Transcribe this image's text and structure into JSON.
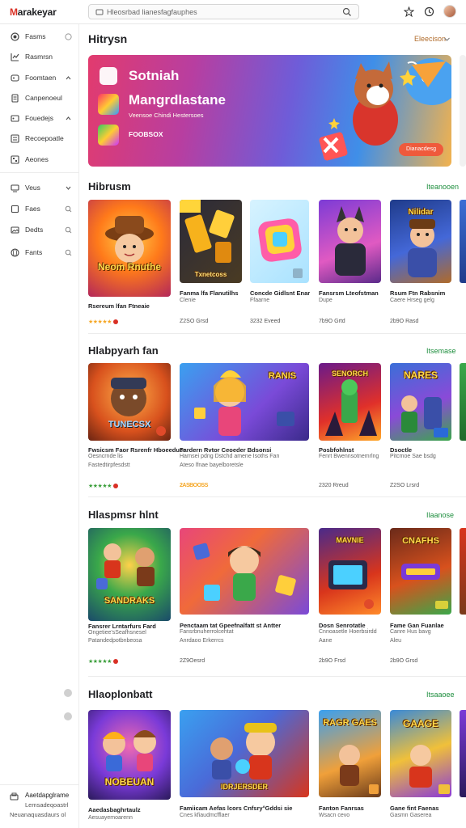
{
  "header": {
    "logo_prefix": "M",
    "logo_rest": "arakeyar",
    "search_placeholder": "Hleosrbad lianesfagfauphes",
    "icons": [
      "search-icon",
      "star-icon",
      "clock-icon",
      "avatar"
    ]
  },
  "sidebar": {
    "items": [
      {
        "label": "Fasms",
        "icon": "circle-icon",
        "right": "radio-icon"
      },
      {
        "label": "Rasmrsn",
        "icon": "chart-icon",
        "right": ""
      },
      {
        "label": "Foomtaen",
        "icon": "gamepad-icon",
        "right": "chevron-up-icon"
      },
      {
        "label": "Canpenoeul",
        "icon": "document-icon",
        "right": ""
      },
      {
        "label": "Fouedejs",
        "icon": "tag-icon",
        "right": "chevron-up-icon"
      },
      {
        "label": "Recoepoatle",
        "icon": "list-icon",
        "right": ""
      },
      {
        "label": "Aeones",
        "icon": "grid-icon",
        "right": ""
      },
      {
        "label": "Veus",
        "icon": "monitor-icon",
        "right": "chevron-down-icon"
      },
      {
        "label": "Faes",
        "icon": "square-icon",
        "right": "search-icon"
      },
      {
        "label": "Dedts",
        "icon": "image-icon",
        "right": "search-icon"
      },
      {
        "label": "Fants",
        "icon": "globe-icon",
        "right": "search-icon"
      }
    ],
    "footer": {
      "line1": "Aaetdapglrame",
      "line2": "Lemsadeqoastrl",
      "line3": "Neuanaquasdaurs ol"
    }
  },
  "main": {
    "title": "Hitrysn",
    "sort_label": "Eleecison",
    "hero": {
      "line1": "Sotniah",
      "line2": "Mangrdlastane",
      "subtitle": "Veensoe Chindi Hestersoes",
      "tag": "FOOBSOX",
      "cta": "Dianacdesg"
    },
    "sections": [
      {
        "title": "Hibrusm",
        "more": "Iteanooen",
        "cards": [
          {
            "title": "Rsereum lfan Ftneaie",
            "sub": "",
            "price": "",
            "stars": "★★★★★",
            "thumb_text": "Neom Rnuthe"
          },
          {
            "title": "Fanma lfa Flanutilhs",
            "sub": "Clenie",
            "price": "Z2SO Grsd",
            "stars": "",
            "thumb_text": "Txnetcoss"
          },
          {
            "title": "Concde Gidlsnt Enar",
            "sub": "Ffaarne",
            "price": "3232 Eveed",
            "stars": "",
            "thumb_text": ""
          },
          {
            "title": "Fansrsm Lteofstman",
            "sub": "Dupe",
            "price": "7b9O Grtd",
            "stars": "",
            "thumb_text": ""
          },
          {
            "title": "Rsum Ftn Rabsnim",
            "sub": "Caere Hrseg gelg",
            "price": "2b9O Rasd",
            "stars": "",
            "thumb_text": "Nilidar"
          }
        ]
      },
      {
        "title": "Hlabpyarh fan",
        "more": "Itsemase",
        "cards": [
          {
            "title": "Fwsicsm Faor Rsrenfr Hboeeduer",
            "sub": "Oesncrnde lis",
            "price": "Fastedtirpfesdstt",
            "stars": "★★★★★",
            "thumb_text": "TUNECSX"
          },
          {
            "title": "Fardern Rvtor Ceoeder Bdsonsi",
            "sub": "Harnsei pdng Dstchd amene Isoths Fan",
            "price": "Ateso lfnae bayelboretsle",
            "stars": "2ASBOOSS",
            "thumb_text": "RANIS"
          },
          {
            "title": "Posbfohlnst",
            "sub": "Fenrt Bwennsotnemrlng",
            "price": "2320 Rreud",
            "stars": "",
            "thumb_text": "SENORCH"
          },
          {
            "title": "Dsoctle",
            "sub": "Pitcmoe Sae bsdg",
            "price": "Z2SO Lrsrd",
            "stars": "",
            "thumb_text": "NARES"
          }
        ]
      },
      {
        "title": "Hlaspmsr hlnt",
        "more": "Ilaanose",
        "cards": [
          {
            "title": "Fansrer Lrntarfurs Fard",
            "sub": "Ongetiee'sSeafhsnesel",
            "price": "Patandedpotbnbeosa",
            "stars": "★★★★★",
            "thumb_text": "SANDRAKS"
          },
          {
            "title": "Penctaam tat Gpeefnalfatt st Antter",
            "sub": "Fansrbnuherrolcehtat",
            "price": "Anrdaoo Erkerrcs",
            "stars": "2Z9Oesrd",
            "thumb_text": ""
          },
          {
            "title": "Dosn Senrotatle",
            "sub": "Cnnoasetle Hoerbsirdd",
            "price": "Aane",
            "stars": "2b9O Frsd",
            "thumb_text": "MAVNIE"
          },
          {
            "title": "Fame Gan Fuanlae",
            "sub": "Canre Hus bavg",
            "price": "Aleu",
            "stars": "2b9O Grsd",
            "thumb_text": "CNAFHS"
          }
        ]
      },
      {
        "title": "Hlaoplonbatt",
        "more": "Itsaaoee",
        "cards": [
          {
            "title": "Aaedasbaghrtaulz",
            "sub": "Aesuayemoarenn",
            "price": "",
            "stars": "",
            "thumb_text": "NOBEUAN"
          },
          {
            "title": "Famiicam Aefas lcors Cnfsry°Gddsi sie",
            "sub": "Cnes kfiaudmcfflaer",
            "price": "",
            "stars": "",
            "thumb_text": "IDRJERSDER"
          },
          {
            "title": "Fanton Fanrsas",
            "sub": "Wsacn cevo",
            "price": "",
            "stars": "",
            "thumb_text": "RAGR GAES"
          },
          {
            "title": "Gane fint Faenas",
            "sub": "Gasmn Gaserea",
            "price": "",
            "stars": "",
            "thumb_text": "GAAGE"
          }
        ]
      }
    ]
  },
  "colors": {
    "accent_green": "#1e8e3e",
    "accent_orange": "#b06b2a",
    "logo_red": "#d93025",
    "cta": "#ef5a3c"
  }
}
